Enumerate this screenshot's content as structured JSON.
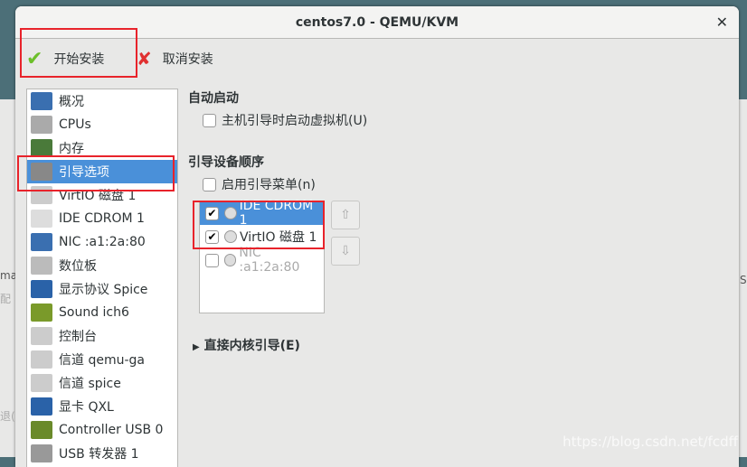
{
  "window": {
    "title": "centos7.0 - QEMU/KVM",
    "close_icon": "close-icon"
  },
  "toolbar": {
    "begin_install": "开始安装",
    "cancel_install": "取消安装"
  },
  "sidebar": {
    "items": [
      {
        "label": "概况",
        "icon": "monitor-icon"
      },
      {
        "label": "CPUs",
        "icon": "cpu-icon"
      },
      {
        "label": "内存",
        "icon": "memory-icon"
      },
      {
        "label": "引导选项",
        "icon": "gears-icon",
        "selected": true
      },
      {
        "label": "VirtIO 磁盘 1",
        "icon": "disk-icon"
      },
      {
        "label": "IDE CDROM 1",
        "icon": "cdrom-icon"
      },
      {
        "label": "NIC :a1:2a:80",
        "icon": "network-icon"
      },
      {
        "label": "数位板",
        "icon": "tablet-icon"
      },
      {
        "label": "显示协议 Spice",
        "icon": "display-icon"
      },
      {
        "label": "Sound ich6",
        "icon": "sound-icon"
      },
      {
        "label": "控制台",
        "icon": "serial-icon"
      },
      {
        "label": "信道 qemu-ga",
        "icon": "serial-icon"
      },
      {
        "label": "信道 spice",
        "icon": "serial-icon"
      },
      {
        "label": "显卡 QXL",
        "icon": "display-icon"
      },
      {
        "label": "Controller USB 0",
        "icon": "pci-card-icon"
      },
      {
        "label": "USB 转发器 1",
        "icon": "usb-icon"
      }
    ]
  },
  "main": {
    "autostart_heading": "自动启动",
    "autostart_checkbox": "主机引导时启动虚拟机(U)",
    "autostart_checked": false,
    "boot_order_heading": "引导设备顺序",
    "boot_menu_checkbox": "启用引导菜单(n)",
    "boot_menu_checked": false,
    "boot_devices": [
      {
        "label": "IDE CDROM 1",
        "checked": true,
        "selected": true
      },
      {
        "label": "VirtIO 磁盘 1",
        "checked": true
      },
      {
        "label": "NIC :a1:2a:80",
        "checked": false
      }
    ],
    "kernel_boot_expander": "直接内核引导(E)"
  },
  "background": {
    "left_text_1": "mag",
    "left_text_2": "配",
    "left_text_3": "退(",
    "right_text": "S"
  },
  "watermark": "https://blog.csdn.net/fcdff"
}
